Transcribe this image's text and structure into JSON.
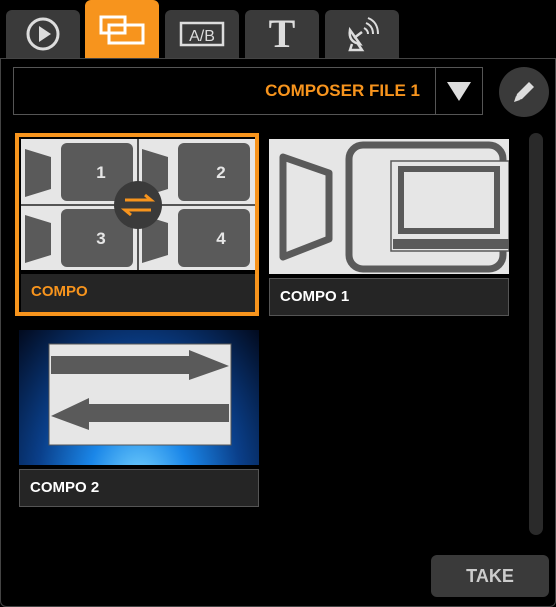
{
  "tabs": [
    {
      "id": "play",
      "icon": "play-icon",
      "active": false
    },
    {
      "id": "composer",
      "icon": "composer-icon",
      "active": true
    },
    {
      "id": "ab",
      "icon": "ab-switch-icon",
      "label": "A/B",
      "active": false
    },
    {
      "id": "text",
      "icon": "text-icon",
      "label": "T",
      "active": false
    },
    {
      "id": "broadcast",
      "icon": "satellite-dish-icon",
      "active": false
    }
  ],
  "file_selector": {
    "value": "COMPOSER FILE 1"
  },
  "compositions": [
    {
      "label": "COMPO",
      "selected": true,
      "cells": [
        "1",
        "2",
        "3",
        "4"
      ]
    },
    {
      "label": "COMPO 1",
      "selected": false
    },
    {
      "label": "COMPO 2",
      "selected": false
    }
  ],
  "actions": {
    "take_label": "TAKE"
  },
  "colors": {
    "accent": "#f7941d",
    "tab_bg": "#3a3a3a",
    "panel_bg": "#000000",
    "label_bg": "#252525"
  }
}
